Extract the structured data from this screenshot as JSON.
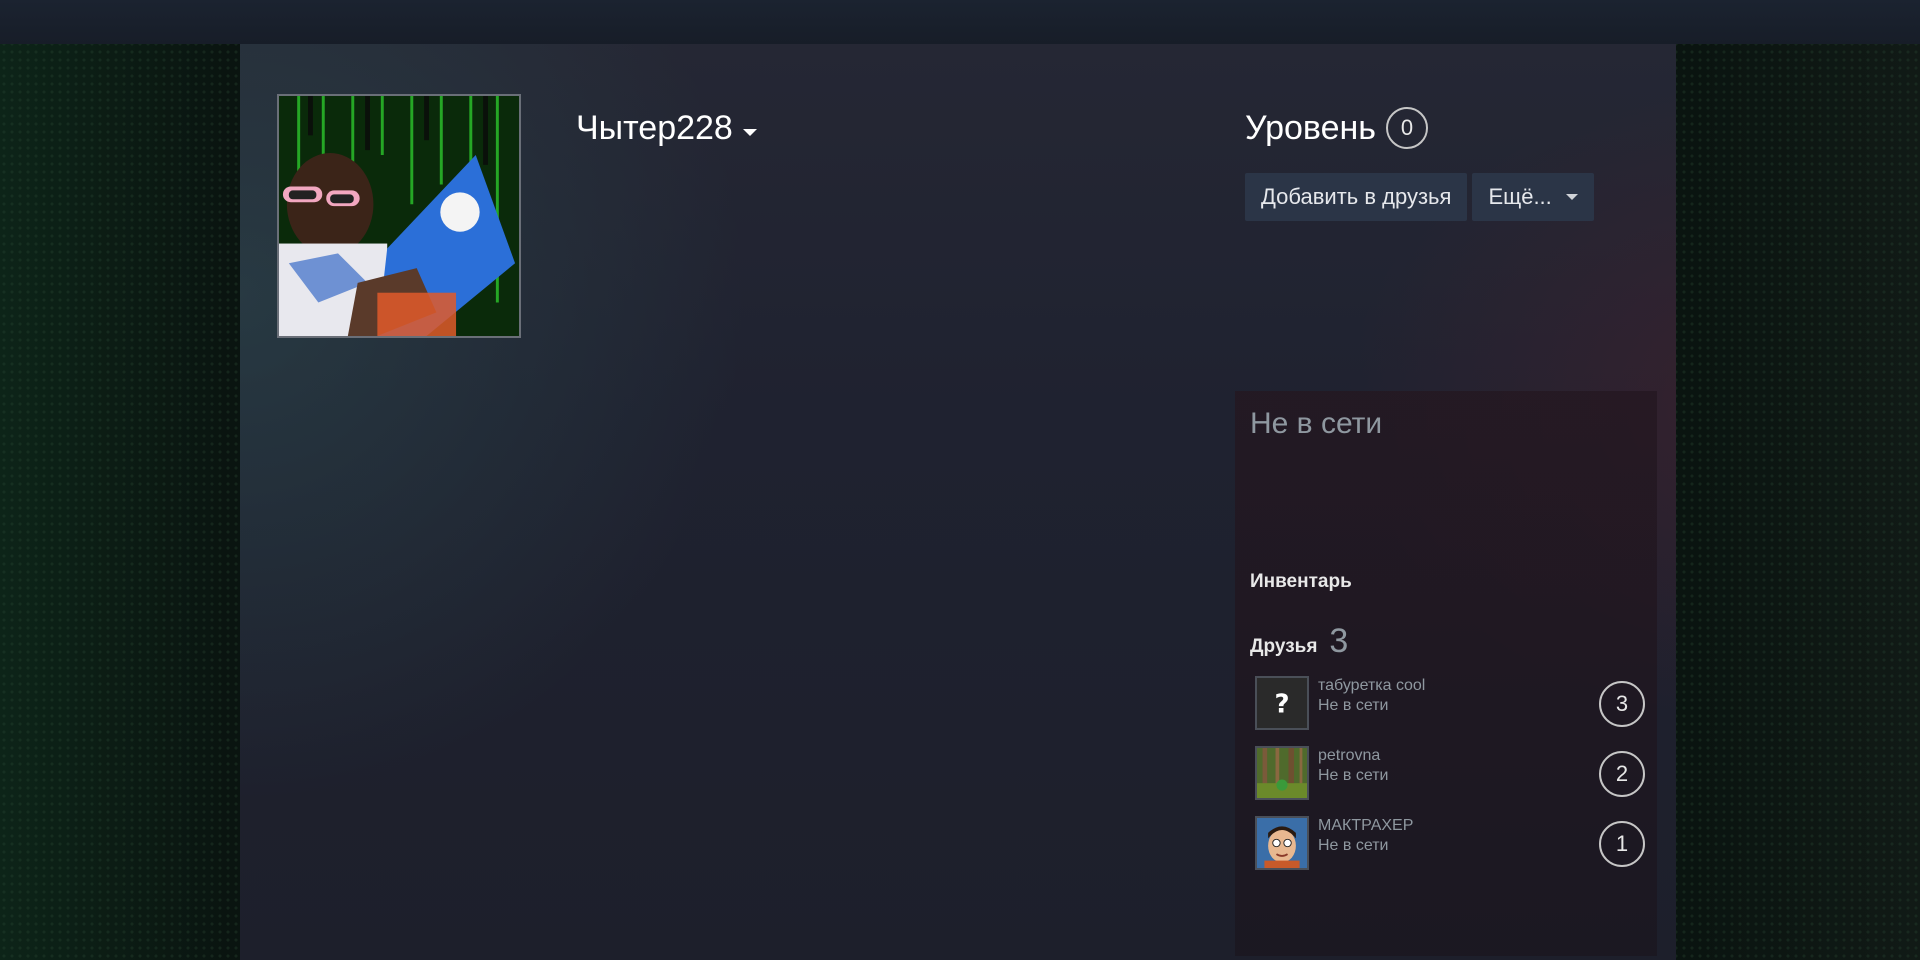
{
  "profile": {
    "persona_name": "Чытер228",
    "level_label": "Уровень",
    "level_value": "0",
    "actions": {
      "add_friend_label": "Добавить в друзья",
      "more_label": "Ещё..."
    },
    "status": "Не в сети",
    "inventory_label": "Инвентарь",
    "friends": {
      "label": "Друзья",
      "count": "3",
      "items": [
        {
          "name": "табуретка cool",
          "status": "Не в сети",
          "level": "3",
          "avatar": "question-mark-icon"
        },
        {
          "name": "petrovna",
          "status": "Не в сети",
          "level": "2",
          "avatar": "forest-avatar"
        },
        {
          "name": "МАКТРАХЕР",
          "status": "Не в сети",
          "level": "1",
          "avatar": "face-avatar"
        }
      ]
    }
  },
  "colors": {
    "button_bg": "#2b3547",
    "muted_text": "#8f98a0",
    "panel_bg": "#1f2230"
  }
}
